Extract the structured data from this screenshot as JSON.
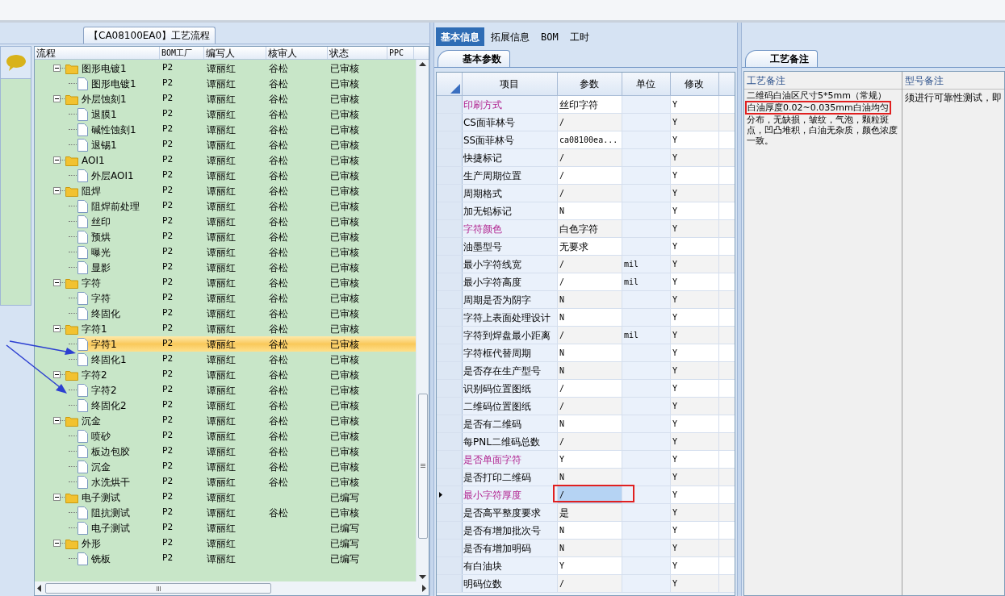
{
  "flow_panel": {
    "title": "【CA08100EA0】工艺流程",
    "columns": [
      "流程",
      "BOM工厂",
      "编写人",
      "核审人",
      "状态",
      "PPC"
    ],
    "rows": [
      {
        "kind": "folder",
        "name": "图形电镀1",
        "factory": "P2",
        "writer": "谭丽红",
        "reviewer": "谷松",
        "status": "已审核",
        "expanded": true,
        "selected": false,
        "children": [
          {
            "kind": "file",
            "name": "图形电镀1",
            "factory": "P2",
            "writer": "谭丽红",
            "reviewer": "谷松",
            "status": "已审核",
            "selected": false
          }
        ]
      },
      {
        "kind": "folder",
        "name": "外层蚀刻1",
        "factory": "P2",
        "writer": "谭丽红",
        "reviewer": "谷松",
        "status": "已审核",
        "expanded": true,
        "selected": false,
        "children": [
          {
            "kind": "file",
            "name": "退膜1",
            "factory": "P2",
            "writer": "谭丽红",
            "reviewer": "谷松",
            "status": "已审核",
            "selected": false
          },
          {
            "kind": "file",
            "name": "碱性蚀刻1",
            "factory": "P2",
            "writer": "谭丽红",
            "reviewer": "谷松",
            "status": "已审核",
            "selected": false
          },
          {
            "kind": "file",
            "name": "退锡1",
            "factory": "P2",
            "writer": "谭丽红",
            "reviewer": "谷松",
            "status": "已审核",
            "selected": false
          }
        ]
      },
      {
        "kind": "folder",
        "name": "AOI1",
        "factory": "P2",
        "writer": "谭丽红",
        "reviewer": "谷松",
        "status": "已审核",
        "expanded": true,
        "selected": false,
        "children": [
          {
            "kind": "file",
            "name": "外层AOI1",
            "factory": "P2",
            "writer": "谭丽红",
            "reviewer": "谷松",
            "status": "已审核",
            "selected": false
          }
        ]
      },
      {
        "kind": "folder",
        "name": "阻焊",
        "factory": "P2",
        "writer": "谭丽红",
        "reviewer": "谷松",
        "status": "已审核",
        "expanded": true,
        "selected": false,
        "children": [
          {
            "kind": "file",
            "name": "阻焊前处理",
            "factory": "P2",
            "writer": "谭丽红",
            "reviewer": "谷松",
            "status": "已审核",
            "selected": false
          },
          {
            "kind": "file",
            "name": "丝印",
            "factory": "P2",
            "writer": "谭丽红",
            "reviewer": "谷松",
            "status": "已审核",
            "selected": false
          },
          {
            "kind": "file",
            "name": "预烘",
            "factory": "P2",
            "writer": "谭丽红",
            "reviewer": "谷松",
            "status": "已审核",
            "selected": false
          },
          {
            "kind": "file",
            "name": "曝光",
            "factory": "P2",
            "writer": "谭丽红",
            "reviewer": "谷松",
            "status": "已审核",
            "selected": false
          },
          {
            "kind": "file",
            "name": "显影",
            "factory": "P2",
            "writer": "谭丽红",
            "reviewer": "谷松",
            "status": "已审核",
            "selected": false
          }
        ]
      },
      {
        "kind": "folder",
        "name": "字符",
        "factory": "P2",
        "writer": "谭丽红",
        "reviewer": "谷松",
        "status": "已审核",
        "expanded": true,
        "selected": false,
        "children": [
          {
            "kind": "file",
            "name": "字符",
            "factory": "P2",
            "writer": "谭丽红",
            "reviewer": "谷松",
            "status": "已审核",
            "selected": false
          },
          {
            "kind": "file",
            "name": "终固化",
            "factory": "P2",
            "writer": "谭丽红",
            "reviewer": "谷松",
            "status": "已审核",
            "selected": false
          }
        ]
      },
      {
        "kind": "folder",
        "name": "字符1",
        "factory": "P2",
        "writer": "谭丽红",
        "reviewer": "谷松",
        "status": "已审核",
        "expanded": true,
        "selected": false,
        "children": [
          {
            "kind": "file",
            "name": "字符1",
            "factory": "P2",
            "writer": "谭丽红",
            "reviewer": "谷松",
            "status": "已审核",
            "selected": true
          },
          {
            "kind": "file",
            "name": "终固化1",
            "factory": "P2",
            "writer": "谭丽红",
            "reviewer": "谷松",
            "status": "已审核",
            "selected": false
          }
        ]
      },
      {
        "kind": "folder",
        "name": "字符2",
        "factory": "P2",
        "writer": "谭丽红",
        "reviewer": "谷松",
        "status": "已审核",
        "expanded": true,
        "selected": false,
        "children": [
          {
            "kind": "file",
            "name": "字符2",
            "factory": "P2",
            "writer": "谭丽红",
            "reviewer": "谷松",
            "status": "已审核",
            "selected": false
          },
          {
            "kind": "file",
            "name": "终固化2",
            "factory": "P2",
            "writer": "谭丽红",
            "reviewer": "谷松",
            "status": "已审核",
            "selected": false
          }
        ]
      },
      {
        "kind": "folder",
        "name": "沉金",
        "factory": "P2",
        "writer": "谭丽红",
        "reviewer": "谷松",
        "status": "已审核",
        "expanded": true,
        "selected": false,
        "children": [
          {
            "kind": "file",
            "name": "喷砂",
            "factory": "P2",
            "writer": "谭丽红",
            "reviewer": "谷松",
            "status": "已审核",
            "selected": false
          },
          {
            "kind": "file",
            "name": "板边包胶",
            "factory": "P2",
            "writer": "谭丽红",
            "reviewer": "谷松",
            "status": "已审核",
            "selected": false
          },
          {
            "kind": "file",
            "name": "沉金",
            "factory": "P2",
            "writer": "谭丽红",
            "reviewer": "谷松",
            "status": "已审核",
            "selected": false
          },
          {
            "kind": "file",
            "name": "水洗烘干",
            "factory": "P2",
            "writer": "谭丽红",
            "reviewer": "谷松",
            "status": "已审核",
            "selected": false
          }
        ]
      },
      {
        "kind": "folder",
        "name": "电子测试",
        "factory": "P2",
        "writer": "谭丽红",
        "status": "已编写",
        "expanded": true,
        "selected": false,
        "children": [
          {
            "kind": "file",
            "name": "阻抗测试",
            "factory": "P2",
            "writer": "谭丽红",
            "reviewer": "谷松",
            "status": "已审核",
            "selected": false
          },
          {
            "kind": "file",
            "name": "电子测试",
            "factory": "P2",
            "writer": "谭丽红",
            "status": "已编写",
            "selected": false
          }
        ]
      },
      {
        "kind": "folder",
        "name": "外形",
        "factory": "P2",
        "writer": "谭丽红",
        "status": "已编写",
        "expanded": true,
        "selected": false,
        "children": [
          {
            "kind": "file",
            "name": "铣板",
            "factory": "P2",
            "writer": "谭丽红",
            "status": "已编写",
            "selected": false
          }
        ]
      }
    ]
  },
  "detail_panel": {
    "tabs": [
      {
        "label": "基本信息",
        "selected": true
      },
      {
        "label": "拓展信息",
        "selected": false
      },
      {
        "label": "BOM",
        "selected": false
      },
      {
        "label": "工时",
        "selected": false
      }
    ],
    "subtab": "基本参数",
    "columns": [
      "项目",
      "参数",
      "单位",
      "修改"
    ],
    "rows": [
      {
        "item": "印刷方式",
        "param": "丝印字符",
        "modified": "Y",
        "highlighted": true,
        "selected": false
      },
      {
        "item": "CS面菲林号",
        "param": "/",
        "modified": "Y",
        "highlighted": false,
        "selected": false
      },
      {
        "item": "SS面菲林号",
        "param": "ca08100ea...",
        "modified": "Y",
        "highlighted": false,
        "selected": false
      },
      {
        "item": "快捷标记",
        "param": "/",
        "modified": "Y",
        "highlighted": false,
        "selected": false
      },
      {
        "item": "生产周期位置",
        "param": "/",
        "modified": "Y",
        "highlighted": false,
        "selected": false
      },
      {
        "item": "周期格式",
        "param": "/",
        "modified": "Y",
        "highlighted": false,
        "selected": false
      },
      {
        "item": "加无铅标记",
        "param": "N",
        "modified": "Y",
        "highlighted": false,
        "selected": false
      },
      {
        "item": "字符颜色",
        "param": "白色字符",
        "modified": "Y",
        "highlighted": true,
        "selected": false
      },
      {
        "item": "油墨型号",
        "param": "无要求",
        "modified": "Y",
        "highlighted": false,
        "selected": false
      },
      {
        "item": "最小字符线宽",
        "param": "/",
        "unit": "mil",
        "modified": "Y",
        "highlighted": false,
        "selected": false
      },
      {
        "item": "最小字符高度",
        "param": "/",
        "unit": "mil",
        "modified": "Y",
        "highlighted": false,
        "selected": false
      },
      {
        "item": "周期是否为阴字",
        "param": "N",
        "modified": "Y",
        "highlighted": false,
        "selected": false
      },
      {
        "item": "字符上表面处理设计",
        "param": "N",
        "modified": "Y",
        "highlighted": false,
        "selected": false
      },
      {
        "item": "字符到焊盘最小距离",
        "param": "/",
        "unit": "mil",
        "modified": "Y",
        "highlighted": false,
        "selected": false
      },
      {
        "item": "字符框代替周期",
        "param": "N",
        "modified": "Y",
        "highlighted": false,
        "selected": false
      },
      {
        "item": "是否存在生产型号",
        "param": "N",
        "modified": "Y",
        "highlighted": false,
        "selected": false
      },
      {
        "item": "识别码位置图纸",
        "param": "/",
        "modified": "Y",
        "highlighted": false,
        "selected": false
      },
      {
        "item": "二维码位置图纸",
        "param": "/",
        "modified": "Y",
        "highlighted": false,
        "selected": false
      },
      {
        "item": "是否有二维码",
        "param": "N",
        "modified": "Y",
        "highlighted": false,
        "selected": false
      },
      {
        "item": "每PNL二维码总数",
        "param": "/",
        "modified": "Y",
        "highlighted": false,
        "selected": false
      },
      {
        "item": "是否单面字符",
        "param": "Y",
        "modified": "Y",
        "highlighted": true,
        "selected": false
      },
      {
        "item": "是否打印二维码",
        "param": "N",
        "modified": "Y",
        "highlighted": false,
        "selected": false
      },
      {
        "item": "最小字符厚度",
        "param": "/",
        "modified": "Y",
        "highlighted": true,
        "selected": true
      },
      {
        "item": "是否高平整度要求",
        "param": "是",
        "modified": "Y",
        "highlighted": false,
        "selected": false
      },
      {
        "item": "是否有增加批次号",
        "param": "N",
        "modified": "Y",
        "highlighted": false,
        "selected": false
      },
      {
        "item": "是否有增加明码",
        "param": "N",
        "modified": "Y",
        "highlighted": false,
        "selected": false
      },
      {
        "item": "有白油块",
        "param": "Y",
        "modified": "Y",
        "highlighted": false,
        "selected": false
      },
      {
        "item": "明码位数",
        "param": "/",
        "modified": "Y",
        "highlighted": false,
        "selected": false
      }
    ]
  },
  "notes_panel": {
    "subtab": "工艺备注",
    "columns": [
      "工艺备注",
      "型号备注"
    ],
    "process_note": [
      "二维码白油区尺寸5*5mm（常规）",
      "白油厚度0.02~0.035mm白油均匀",
      "分布，无缺损，皱纹，气泡，颗粒斑点，凹凸堆积，白油无杂质，颜色浓度一致。"
    ],
    "model_note": "须进行可靠性测试，即"
  }
}
